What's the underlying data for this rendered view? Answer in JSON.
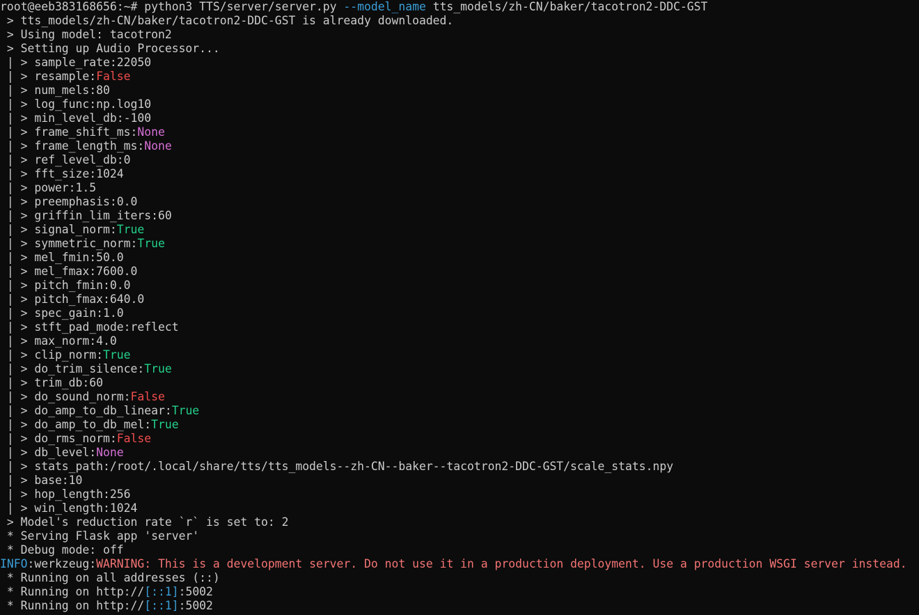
{
  "terminal": {
    "colors": {
      "background": "#0c0c0c",
      "default": "#cccccc",
      "red": "#e74856",
      "green": "#16c60c",
      "magenta": "#b4009e",
      "cyan": "#3a96dd",
      "true_color": "#23d18b",
      "false_color": "#f14c4c",
      "none_color": "#d670d6",
      "arg_color": "#3b9ed8",
      "warning_color": "#f47474",
      "info_color": "#3b9ed8"
    },
    "lines": [
      [
        {
          "t": "root@eeb383168656:~# python3 TTS/server/server.py ",
          "c": "default"
        },
        {
          "t": "--model_name",
          "c": "arg"
        },
        {
          "t": " tts_models/zh-CN/baker/tacotron2-DDC-GST",
          "c": "default"
        }
      ],
      [
        {
          "t": " > tts_models/zh-CN/baker/tacotron2-DDC-GST is already downloaded.",
          "c": "default"
        }
      ],
      [
        {
          "t": " > Using model: tacotron2",
          "c": "default"
        }
      ],
      [
        {
          "t": " > Setting up Audio Processor...",
          "c": "default"
        }
      ],
      [
        {
          "t": " | > sample_rate:22050",
          "c": "default"
        }
      ],
      [
        {
          "t": " | > resample:",
          "c": "default"
        },
        {
          "t": "False",
          "c": "false"
        }
      ],
      [
        {
          "t": " | > num_mels:80",
          "c": "default"
        }
      ],
      [
        {
          "t": " | > log_func:np.log10",
          "c": "default"
        }
      ],
      [
        {
          "t": " | > min_level_db:-100",
          "c": "default"
        }
      ],
      [
        {
          "t": " | > frame_shift_ms:",
          "c": "default"
        },
        {
          "t": "None",
          "c": "none"
        }
      ],
      [
        {
          "t": " | > frame_length_ms:",
          "c": "default"
        },
        {
          "t": "None",
          "c": "none"
        }
      ],
      [
        {
          "t": " | > ref_level_db:0",
          "c": "default"
        }
      ],
      [
        {
          "t": " | > fft_size:1024",
          "c": "default"
        }
      ],
      [
        {
          "t": " | > power:1.5",
          "c": "default"
        }
      ],
      [
        {
          "t": " | > preemphasis:0.0",
          "c": "default"
        }
      ],
      [
        {
          "t": " | > griffin_lim_iters:60",
          "c": "default"
        }
      ],
      [
        {
          "t": " | > signal_norm:",
          "c": "default"
        },
        {
          "t": "True",
          "c": "true"
        }
      ],
      [
        {
          "t": " | > symmetric_norm:",
          "c": "default"
        },
        {
          "t": "True",
          "c": "true"
        }
      ],
      [
        {
          "t": " | > mel_fmin:50.0",
          "c": "default"
        }
      ],
      [
        {
          "t": " | > mel_fmax:7600.0",
          "c": "default"
        }
      ],
      [
        {
          "t": " | > pitch_fmin:0.0",
          "c": "default"
        }
      ],
      [
        {
          "t": " | > pitch_fmax:640.0",
          "c": "default"
        }
      ],
      [
        {
          "t": " | > spec_gain:1.0",
          "c": "default"
        }
      ],
      [
        {
          "t": " | > stft_pad_mode:reflect",
          "c": "default"
        }
      ],
      [
        {
          "t": " | > max_norm:4.0",
          "c": "default"
        }
      ],
      [
        {
          "t": " | > clip_norm:",
          "c": "default"
        },
        {
          "t": "True",
          "c": "true"
        }
      ],
      [
        {
          "t": " | > do_trim_silence:",
          "c": "default"
        },
        {
          "t": "True",
          "c": "true"
        }
      ],
      [
        {
          "t": " | > trim_db:60",
          "c": "default"
        }
      ],
      [
        {
          "t": " | > do_sound_norm:",
          "c": "default"
        },
        {
          "t": "False",
          "c": "false"
        }
      ],
      [
        {
          "t": " | > do_amp_to_db_linear:",
          "c": "default"
        },
        {
          "t": "True",
          "c": "true"
        }
      ],
      [
        {
          "t": " | > do_amp_to_db_mel:",
          "c": "default"
        },
        {
          "t": "True",
          "c": "true"
        }
      ],
      [
        {
          "t": " | > do_rms_norm:",
          "c": "default"
        },
        {
          "t": "False",
          "c": "false"
        }
      ],
      [
        {
          "t": " | > db_level:",
          "c": "default"
        },
        {
          "t": "None",
          "c": "none"
        }
      ],
      [
        {
          "t": " | > stats_path:/root/.local/share/tts/tts_models--zh-CN--baker--tacotron2-DDC-GST/scale_stats.npy",
          "c": "default"
        }
      ],
      [
        {
          "t": " | > base:10",
          "c": "default"
        }
      ],
      [
        {
          "t": " | > hop_length:256",
          "c": "default"
        }
      ],
      [
        {
          "t": " | > win_length:1024",
          "c": "default"
        }
      ],
      [
        {
          "t": " > Model's reduction rate `r` is set to: 2",
          "c": "default"
        }
      ],
      [
        {
          "t": " * Serving Flask app 'server'",
          "c": "default"
        }
      ],
      [
        {
          "t": " * Debug mode: off",
          "c": "default"
        }
      ],
      [
        {
          "t": "INFO",
          "c": "info"
        },
        {
          "t": ":werkzeug:",
          "c": "default"
        },
        {
          "t": "WARNING: This is a development server. Do not use it in a production deployment. Use a production WSGI server instead.",
          "c": "warning"
        }
      ],
      [
        {
          "t": " * Running on all addresses (::)",
          "c": "default"
        }
      ],
      [
        {
          "t": " * Running on http://",
          "c": "default"
        },
        {
          "t": "[::1]",
          "c": "arg"
        },
        {
          "t": ":5002",
          "c": "default"
        }
      ],
      [
        {
          "t": " * Running on http://",
          "c": "default"
        },
        {
          "t": "[::1]",
          "c": "arg"
        },
        {
          "t": ":5002",
          "c": "default"
        }
      ]
    ]
  }
}
